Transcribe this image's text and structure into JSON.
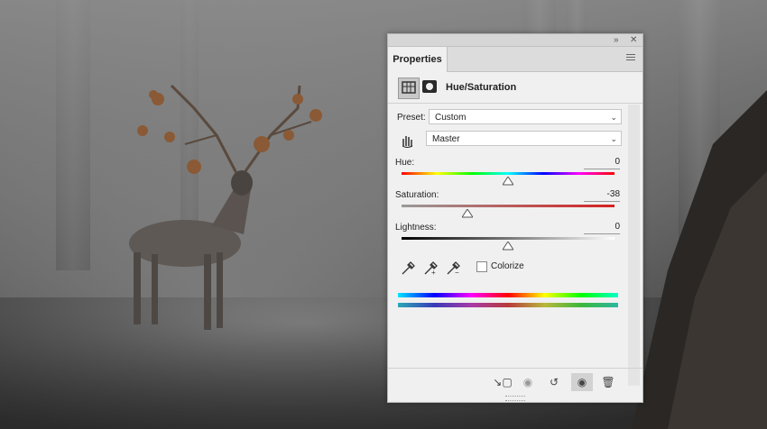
{
  "panel": {
    "tab_label": "Properties",
    "collapse_icon": "double-chevron-right-icon",
    "close_icon": "close-icon",
    "menu_icon": "panel-menu-icon",
    "adjustment_title": "Hue/Saturation",
    "preset_label": "Preset:",
    "preset_value": "Custom",
    "channel_value": "Master",
    "hue": {
      "label": "Hue:",
      "value": "0",
      "level": 0
    },
    "saturation": {
      "label": "Saturation:",
      "value": "-38",
      "level": -38
    },
    "lightness": {
      "label": "Lightness:",
      "value": "0",
      "level": 0
    },
    "colorize_label": "Colorize",
    "colorize_checked": false,
    "footer_buttons": [
      "clip-to-layer-icon",
      "view-previous-state-icon",
      "reset-icon",
      "toggle-visibility-icon",
      "delete-icon"
    ]
  },
  "colors": {
    "panel_bg": "#f0f0f0",
    "accent_track_red": "#d62020"
  }
}
